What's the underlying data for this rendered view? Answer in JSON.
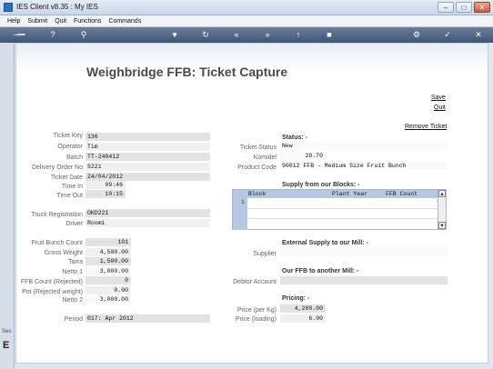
{
  "window": {
    "title": "IES Client v8.35 : My IES"
  },
  "menu": [
    "Help",
    "Submit",
    "Quit",
    "Functions",
    "Commands"
  ],
  "page": {
    "heading": "Weighbridge FFB: Ticket Capture"
  },
  "actions": {
    "save": "Save",
    "quit": "Quit",
    "remove_ticket": "Remove Ticket"
  },
  "left": {
    "ticket_key": {
      "label": "Ticket Key",
      "value": "136"
    },
    "operator": {
      "label": "Operator",
      "value": "Tim"
    },
    "batch": {
      "label": "Batch",
      "value": "TT-240412"
    },
    "delivery_order": {
      "label": "Delivery Order No",
      "value": "5221"
    },
    "ticket_date": {
      "label": "Ticket Date",
      "value": "24/04/2012"
    },
    "time_in": {
      "label": "Time In",
      "value": "09:46"
    },
    "time_out": {
      "label": "Time Out",
      "value": "10:15"
    },
    "truck_registration": {
      "label": "Truck Registration",
      "value": "OKD221"
    },
    "driver": {
      "label": "Driver",
      "value": "Roomi"
    },
    "fruit_bunch_count": {
      "label": "Fruit Bunch Count",
      "value": "101"
    },
    "gross_weight": {
      "label": "Gross Weight",
      "value": "4,500.00"
    },
    "tarra": {
      "label": "Tarra",
      "value": "1,500.00"
    },
    "netto1": {
      "label": "Netto 1",
      "value": "3,000.00"
    },
    "ffb_rejected": {
      "label": "FFB Count (Rejected)",
      "value": "0"
    },
    "pot_rejected": {
      "label": "Pot (Rejected weight)",
      "value": "0.00"
    },
    "netto2": {
      "label": "Netto 2",
      "value": "3,000.00"
    },
    "period": {
      "label": "Period",
      "value": "017: Apr 2012"
    }
  },
  "right": {
    "status_title": "Status: -",
    "ticket_status": {
      "label": "Ticket Status",
      "value": "New"
    },
    "komidel": {
      "label": "Komidel",
      "value": "29.70"
    },
    "product_code": {
      "label": "Product Code",
      "value": "90012 FFB - Medium Size Fruit Bunch"
    },
    "blocks_title": "Supply from our Blocks: -",
    "blocks_columns": [
      "Block",
      "Plant Year",
      "FFB Count"
    ],
    "blocks_row_number": "1",
    "external_title": "External Supply to our Mill: -",
    "supplier": {
      "label": "Supplier",
      "value": ""
    },
    "our_ffb_title": "Our FFB to another Mill: -",
    "debtor_account": {
      "label": "Debtor Account",
      "value": ""
    },
    "pricing_title": "Pricing: -",
    "price_per_kg": {
      "label": "Price (per Kg)",
      "value": "4,200.00"
    },
    "price_loading": {
      "label": "Price (loading)",
      "value": "6.00"
    }
  },
  "left_strip": {
    "label": "Ses",
    "letter": "E"
  }
}
